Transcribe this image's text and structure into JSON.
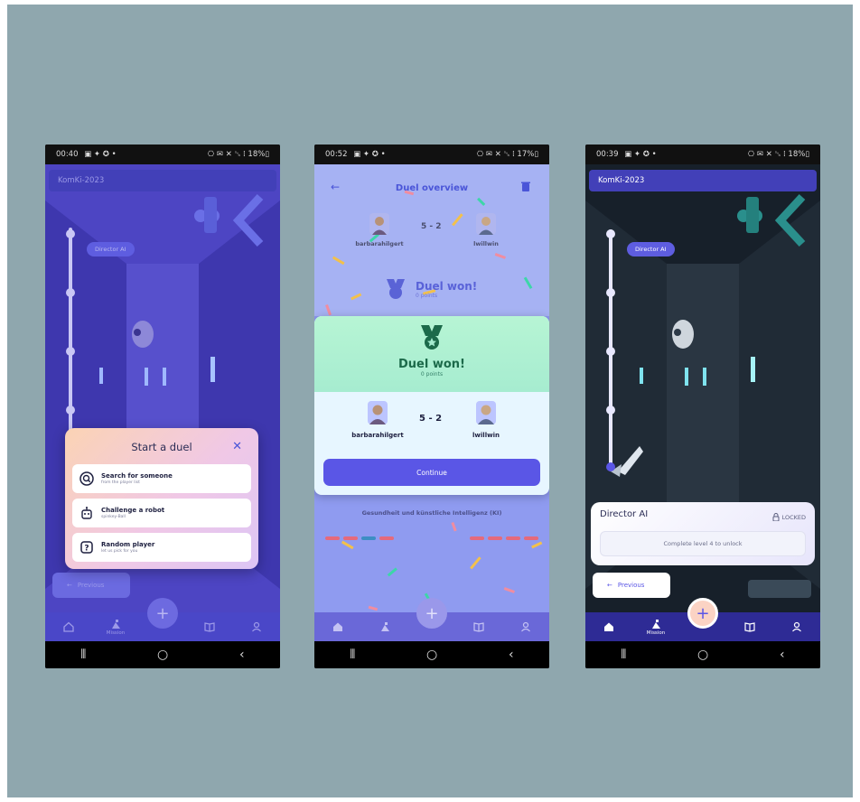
{
  "phones": [
    {
      "status": {
        "time": "00:40",
        "notif": "▣ ✦ ✪ •",
        "right": "⎔ ✉ ✕ ␖ ⁞ 18%▯"
      },
      "app_title": "KomKi-2023",
      "pill": "Director AI",
      "modal": {
        "title": "Start a duel",
        "options": [
          {
            "title": "Search for someone",
            "subtitle": "from the player list"
          },
          {
            "title": "Challenge a robot",
            "subtitle": "spinkey-Ball"
          },
          {
            "title": "Random player",
            "subtitle": "let us pick for you"
          }
        ]
      },
      "previous_label": "Previous",
      "tabs": [
        {
          "label": ""
        },
        {
          "label": "Mission"
        },
        {
          "label": ""
        },
        {
          "label": ""
        }
      ]
    },
    {
      "status": {
        "time": "00:52",
        "notif": "▣ ✦ ✪ •",
        "right": "⎔ ✉ ✕ ␖ ⁞ 17%▯"
      },
      "header": "Duel overview",
      "faded": {
        "left_name": "barbarahilgert",
        "right_name": "lwillwin",
        "score": "5 - 2",
        "won_title": "Duel won!",
        "won_points": "0 points"
      },
      "won": {
        "title": "Duel won!",
        "points": "0 points",
        "left_name": "barbarahilgert",
        "right_name": "lwillwin",
        "score": "5 - 2"
      },
      "continue_label": "Continue",
      "topic": "Gesundheit und künstliche Intelligenz (KI)"
    },
    {
      "status": {
        "time": "00:39",
        "notif": "▣ ✦ ✪ •",
        "right": "⎔ ✉ ✕ ␖ ⁞ 18%▯"
      },
      "app_title": "KomKi-2023",
      "pill": "Director AI",
      "level": {
        "title": "Director AI",
        "locked": "LOCKED",
        "unlock_text": "Complete level 4 to unlock"
      },
      "previous_label": "Previous",
      "tabs": [
        {
          "label": ""
        },
        {
          "label": "Mission"
        },
        {
          "label": ""
        },
        {
          "label": ""
        }
      ]
    }
  ],
  "colors": {
    "background": "#8fa7ae",
    "accent": "#5a56e6",
    "appbar": "#4240b8",
    "won_green": "#1c6a4a",
    "scene_purple": "#4d45c3",
    "scene_dark": "#17202a"
  },
  "icons": {
    "home": "home-icon",
    "mission": "mission-icon",
    "add": "plus-icon",
    "book": "book-icon",
    "profile": "profile-icon",
    "search": "search-icon",
    "robot": "robot-icon",
    "random": "question-icon",
    "trash": "trash-icon",
    "lock": "lock-icon"
  }
}
